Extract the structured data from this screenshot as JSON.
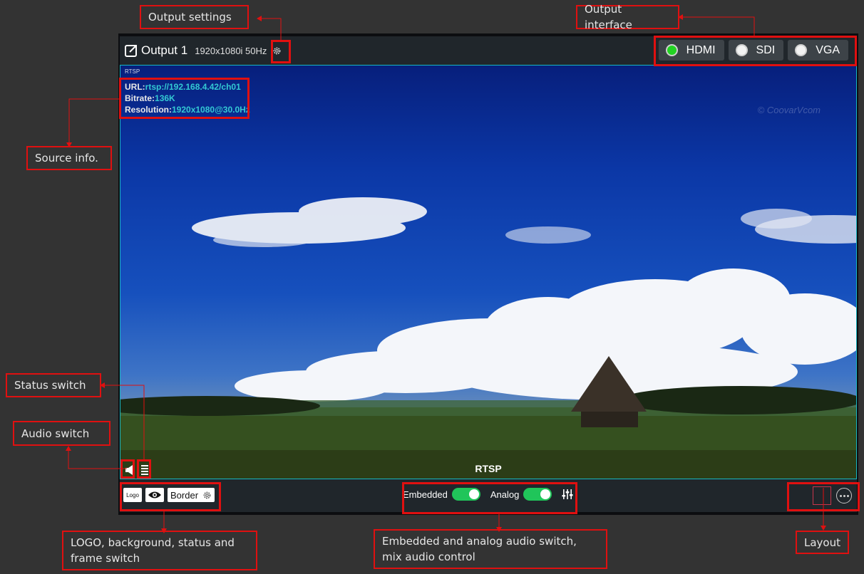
{
  "annotations": {
    "output_settings": "Output settings",
    "output_interface": "Output interface",
    "source_info": "Source info.",
    "status_switch": "Status switch",
    "audio_switch": "Audio switch",
    "logo_bg_frame": "LOGO, background, status and frame switch",
    "audio_mix": "Embedded and analog audio switch, mix audio control",
    "layout": "Layout"
  },
  "header": {
    "title": "Output 1",
    "resolution": "1920x1080i 50Hz",
    "interfaces": [
      {
        "label": "HDMI",
        "active": true
      },
      {
        "label": "SDI",
        "active": false
      },
      {
        "label": "VGA",
        "active": false
      }
    ]
  },
  "preview": {
    "tag": "RTSP",
    "url_label": "URL:",
    "url_value": "rtsp://192.168.4.42/ch01",
    "bitrate_label": "Bitrate:",
    "bitrate_value": "136K",
    "resolution_label": "Resolution:",
    "resolution_value": "1920x1080@30.0Hz",
    "watermark": "© CoovarVcom",
    "source_label": "RTSP"
  },
  "footer": {
    "logo_label": "Logo",
    "border_label": "Border",
    "embedded_label": "Embedded",
    "analog_label": "Analog",
    "embedded_on": true,
    "analog_on": true
  },
  "colors": {
    "accent_red": "#e01010",
    "active_green": "#22d322",
    "toggle_green": "#20c55a",
    "cyan": "#33c9d3"
  }
}
